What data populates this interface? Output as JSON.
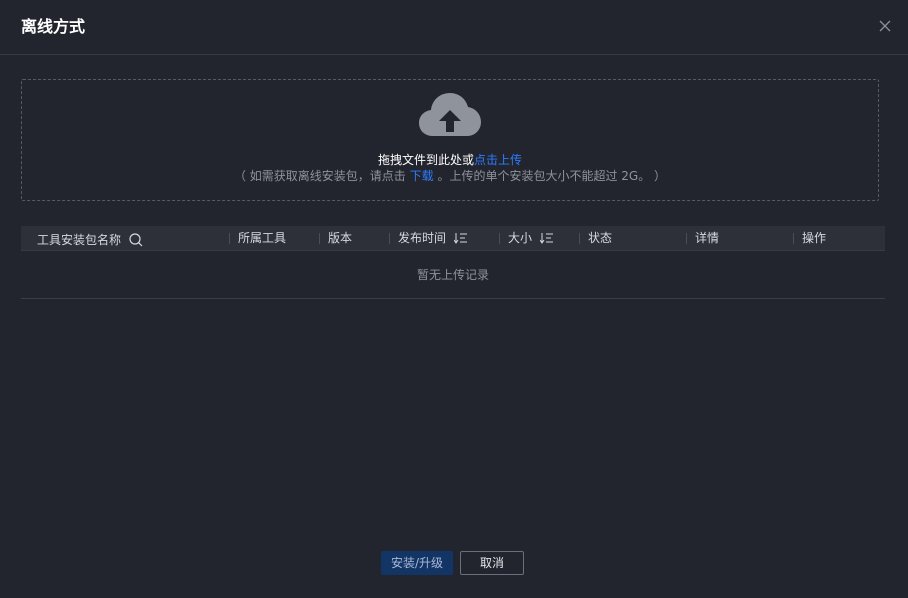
{
  "dialog": {
    "title": "离线方式",
    "close_icon": "close-icon"
  },
  "upload": {
    "icon": "cloud-upload-icon",
    "prompt_prefix": "拖拽文件到此处或",
    "prompt_link": "点击上传",
    "hint_prefix": "（ 如需获取离线安装包，请点击",
    "hint_link": "下载",
    "hint_suffix": "。上传的单个安装包大小不能超过 2G。 ）"
  },
  "table": {
    "columns": [
      {
        "label": "工具安装包名称",
        "icon": "search-icon"
      },
      {
        "label": "所属工具"
      },
      {
        "label": "版本"
      },
      {
        "label": "发布时间",
        "icon": "sort-icon"
      },
      {
        "label": "大小",
        "icon": "sort-icon"
      },
      {
        "label": "状态"
      },
      {
        "label": "详情"
      },
      {
        "label": "操作"
      }
    ],
    "empty_text": "暂无上传记录"
  },
  "footer": {
    "confirm_label": "安装/升级",
    "cancel_label": "取消"
  },
  "colors": {
    "background": "#22252d",
    "link": "#2f7bff",
    "primary_button": "#133566"
  }
}
